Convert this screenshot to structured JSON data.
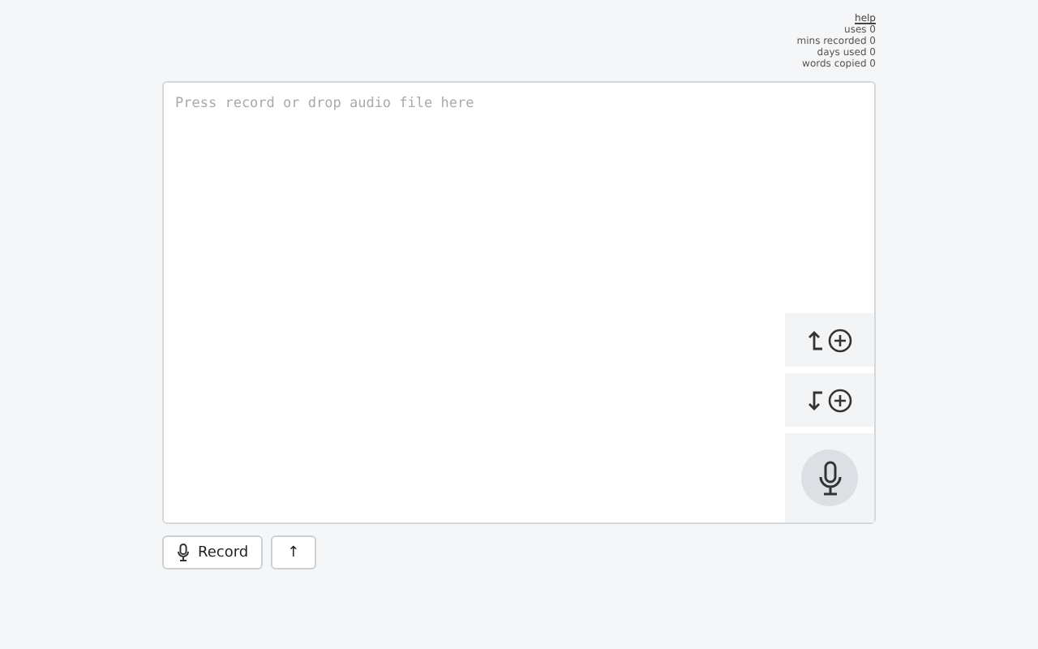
{
  "help_link": "help",
  "stats": [
    {
      "label": "uses",
      "value": "0"
    },
    {
      "label": "mins recorded",
      "value": "0"
    },
    {
      "label": "days used",
      "value": "0"
    },
    {
      "label": "words copied",
      "value": "0"
    }
  ],
  "editor": {
    "placeholder": "Press record or drop audio file here"
  },
  "buttons": [
    {
      "kind": "record",
      "label": "Record"
    },
    {
      "kind": "upload",
      "label": "↑"
    }
  ]
}
